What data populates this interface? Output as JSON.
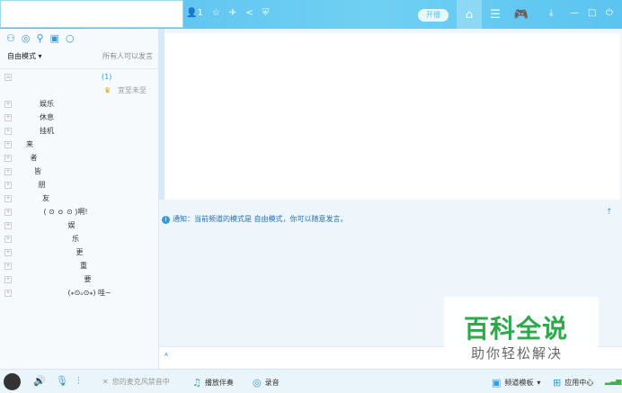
{
  "topbar": {
    "user_count": "1",
    "live_label": "开播",
    "icons": [
      "user-icon",
      "star-icon",
      "plane-icon",
      "share-icon",
      "shield-icon"
    ],
    "nav": [
      "home-icon",
      "list-icon",
      "gamepad-icon"
    ],
    "window": [
      "download-icon",
      "minimize-icon",
      "maximize-icon",
      "power-icon"
    ]
  },
  "left": {
    "icons": [
      "user-icon",
      "chat-icon",
      "location-icon",
      "note-icon",
      "search-icon"
    ],
    "mode": "自由模式",
    "permission": "所有人可以发言",
    "root_count": "(1)",
    "user_name": "宜至未至",
    "tree": [
      {
        "label": "娱乐",
        "indent": 1
      },
      {
        "label": "休息",
        "indent": 1
      },
      {
        "label": "挂机",
        "indent": 1
      },
      {
        "label": "来",
        "indent": 0
      },
      {
        "label": "者",
        "indent": 0.3
      },
      {
        "label": "皆",
        "indent": 0.6
      },
      {
        "label": "朋",
        "indent": 0.9
      },
      {
        "label": "友",
        "indent": 1.2
      },
      {
        "label": "( ⊙ ｏ ⊙ )啊!",
        "indent": 1.3
      },
      {
        "label": "娱",
        "indent": 3.1
      },
      {
        "label": "乐",
        "indent": 3.4
      },
      {
        "label": "更",
        "indent": 3.7
      },
      {
        "label": "重",
        "indent": 4.0
      },
      {
        "label": "要",
        "indent": 4.3
      },
      {
        "label": "(⁎⊙ₒ⊙⁎) 哇~",
        "indent": 3.1
      }
    ]
  },
  "notice": "通知：当前频道的模式是 自由模式，你可以随意发言。",
  "bottom": {
    "mic_status": "您的麦克风禁音中",
    "accompaniment": "播放伴奏",
    "record": "录音",
    "template": "频道模板",
    "app_center": "应用中心"
  },
  "watermark": {
    "title": "百科全说",
    "subtitle": "助你轻松解决"
  },
  "colors": {
    "accent": "#5bc4f0",
    "watermark": "#2da84a"
  }
}
